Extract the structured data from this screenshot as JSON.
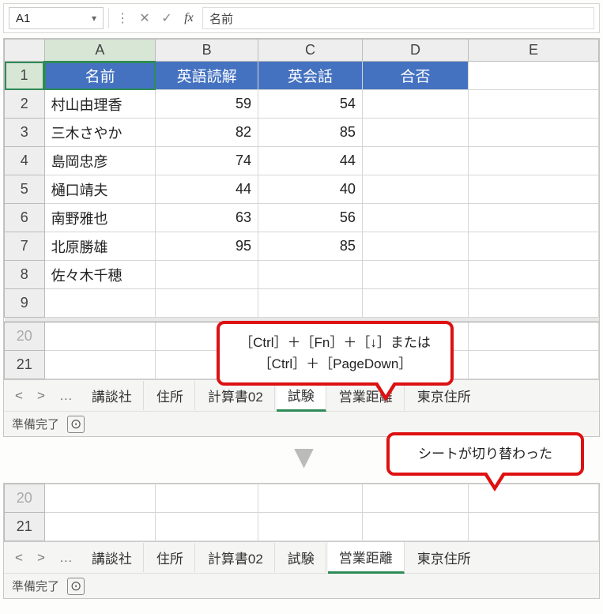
{
  "namebox": "A1",
  "fx_value": "名前",
  "col_headers": [
    "A",
    "B",
    "C",
    "D",
    "E"
  ],
  "row_headers": [
    "1",
    "2",
    "3",
    "4",
    "5",
    "6",
    "7",
    "8",
    "9",
    "20",
    "21"
  ],
  "table_header": {
    "name": "名前",
    "reading": "英語読解",
    "conv": "英会話",
    "pass": "合否"
  },
  "rows": [
    {
      "name": "村山由理香",
      "reading": "59",
      "conv": "54"
    },
    {
      "name": "三木さやか",
      "reading": "82",
      "conv": "85"
    },
    {
      "name": "島岡忠彦",
      "reading": "74",
      "conv": "44"
    },
    {
      "name": "樋口靖夫",
      "reading": "44",
      "conv": "40"
    },
    {
      "name": "南野雅也",
      "reading": "63",
      "conv": "56"
    },
    {
      "name": "北原勝雄",
      "reading": "95",
      "conv": "85"
    },
    {
      "name": "佐々木千穂",
      "reading": "",
      "conv": ""
    }
  ],
  "callout1_l1": "［Ctrl］＋［Fn］＋［↓］または",
  "callout1_l2": "［Ctrl］＋［PageDown］",
  "callout2": "シートが切り替わった",
  "tabs1": {
    "list": [
      "講談社",
      "住所",
      "計算書02",
      "試験",
      "営業距離",
      "東京住所"
    ],
    "active": "試験"
  },
  "tabs2": {
    "list": [
      "講談社",
      "住所",
      "計算書02",
      "試験",
      "営業距離",
      "東京住所"
    ],
    "active": "営業距離"
  },
  "bottom_rows": [
    "20",
    "21"
  ],
  "status": "準備完了",
  "nav_ellipsis": "…"
}
